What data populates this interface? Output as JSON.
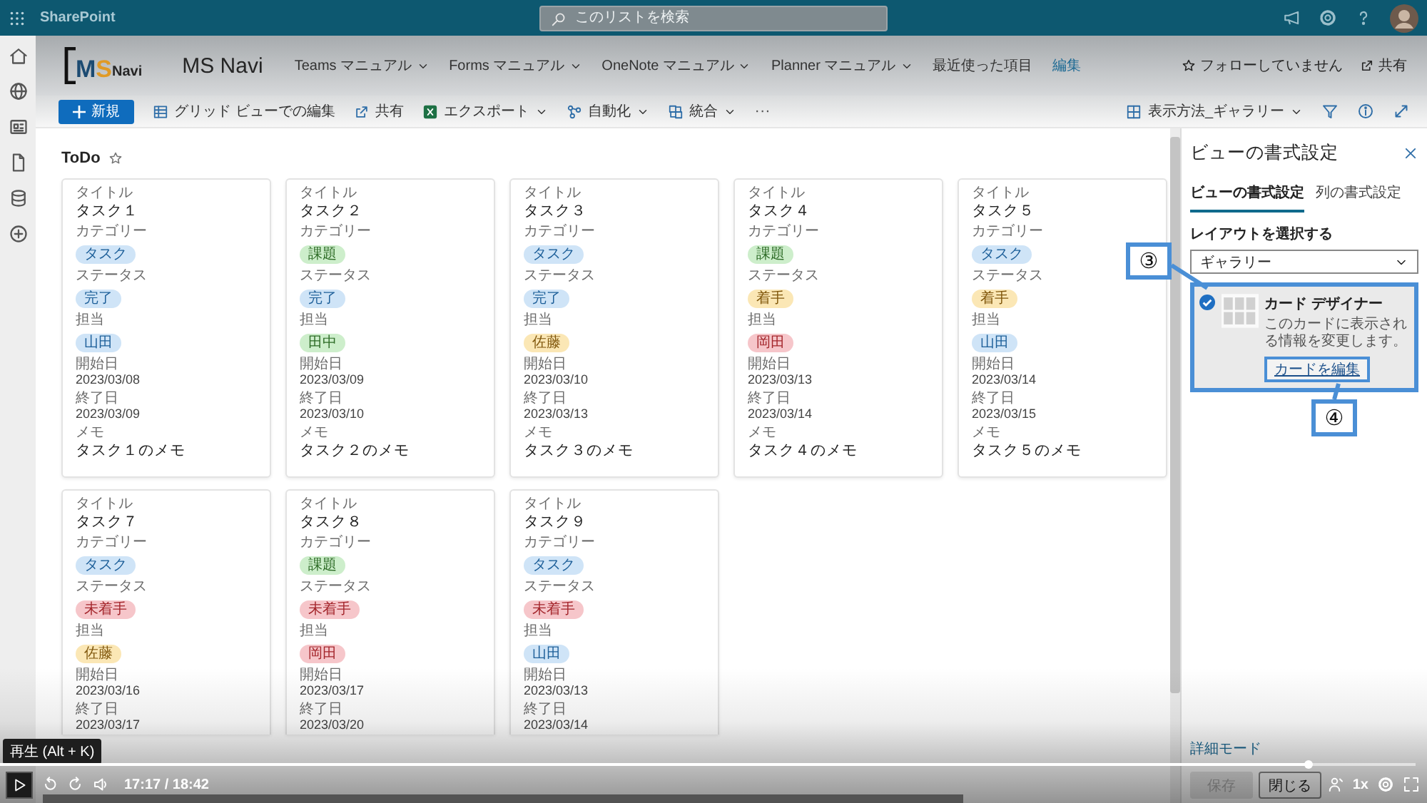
{
  "top_bar": {
    "app_name": "SharePoint",
    "search": {
      "placeholder": "このリストを検索"
    }
  },
  "site_header": {
    "logo_letters": [
      "M",
      "S",
      "Navi"
    ],
    "site_name": "MS Navi",
    "nav": [
      {
        "label": "Teams マニュアル",
        "kind": "menu",
        "dropdown": true
      },
      {
        "label": "Forms マニュアル",
        "kind": "menu",
        "dropdown": true
      },
      {
        "label": "OneNote マニュアル",
        "kind": "menu",
        "dropdown": true
      },
      {
        "label": "Planner マニュアル",
        "kind": "menu",
        "dropdown": true
      },
      {
        "label": "最近使った項目",
        "kind": "menu",
        "dropdown": false
      },
      {
        "label": "編集",
        "kind": "link",
        "dropdown": false
      }
    ],
    "follow": "フォローしていません",
    "share": "共有"
  },
  "command_bar": {
    "new": "新規",
    "items": [
      {
        "label": "グリッド ビューでの編集",
        "kind": "grid",
        "dropdown": false
      },
      {
        "label": "共有",
        "kind": "share",
        "dropdown": false
      },
      {
        "label": "エクスポート",
        "kind": "excel",
        "dropdown": true
      },
      {
        "label": "自動化",
        "kind": "flow",
        "dropdown": true
      },
      {
        "label": "統合",
        "kind": "integrate",
        "dropdown": true
      }
    ],
    "more": "···",
    "view": "表示方法_ギャラリー"
  },
  "list": {
    "title": "ToDo",
    "favorite": false
  },
  "cards": [
    {
      "fields": [
        {
          "kind": "title",
          "label": "タイトル",
          "value": "タスク１"
        },
        {
          "kind": "chip",
          "label": "カテゴリー",
          "value": "タスク",
          "color": "#cfe4f7"
        },
        {
          "kind": "chip",
          "label": "ステータス",
          "value": "完了",
          "color": "#cfe4f7"
        },
        {
          "kind": "chip",
          "label": "担当",
          "value": "山田",
          "color": "#cfe4f7"
        },
        {
          "kind": "date",
          "label": "開始日",
          "value": "2023/03/08"
        },
        {
          "kind": "date",
          "label": "終了日",
          "value": "2023/03/09"
        },
        {
          "kind": "title",
          "label": "メモ",
          "value": "タスク１のメモ"
        }
      ]
    },
    {
      "fields": [
        {
          "kind": "title",
          "label": "タイトル",
          "value": "タスク２"
        },
        {
          "kind": "chip",
          "label": "カテゴリー",
          "value": "課題",
          "color": "#cdeecb"
        },
        {
          "kind": "chip",
          "label": "ステータス",
          "value": "完了",
          "color": "#cfe4f7"
        },
        {
          "kind": "chip",
          "label": "担当",
          "value": "田中",
          "color": "#cdeecb"
        },
        {
          "kind": "date",
          "label": "開始日",
          "value": "2023/03/09"
        },
        {
          "kind": "date",
          "label": "終了日",
          "value": "2023/03/10"
        },
        {
          "kind": "title",
          "label": "メモ",
          "value": "タスク２のメモ"
        }
      ]
    },
    {
      "fields": [
        {
          "kind": "title",
          "label": "タイトル",
          "value": "タスク３"
        },
        {
          "kind": "chip",
          "label": "カテゴリー",
          "value": "タスク",
          "color": "#cfe4f7"
        },
        {
          "kind": "chip",
          "label": "ステータス",
          "value": "完了",
          "color": "#cfe4f7"
        },
        {
          "kind": "chip",
          "label": "担当",
          "value": "佐藤",
          "color": "#fbe7b5"
        },
        {
          "kind": "date",
          "label": "開始日",
          "value": "2023/03/10"
        },
        {
          "kind": "date",
          "label": "終了日",
          "value": "2023/03/13"
        },
        {
          "kind": "title",
          "label": "メモ",
          "value": "タスク３のメモ"
        }
      ]
    },
    {
      "fields": [
        {
          "kind": "title",
          "label": "タイトル",
          "value": "タスク４"
        },
        {
          "kind": "chip",
          "label": "カテゴリー",
          "value": "課題",
          "color": "#cdeecb"
        },
        {
          "kind": "chip",
          "label": "ステータス",
          "value": "着手",
          "color": "#fbe7b5"
        },
        {
          "kind": "chip",
          "label": "担当",
          "value": "岡田",
          "color": "#f6c6ca"
        },
        {
          "kind": "date",
          "label": "開始日",
          "value": "2023/03/13"
        },
        {
          "kind": "date",
          "label": "終了日",
          "value": "2023/03/14"
        },
        {
          "kind": "title",
          "label": "メモ",
          "value": "タスク４のメモ"
        }
      ]
    },
    {
      "fields": [
        {
          "kind": "title",
          "label": "タイトル",
          "value": "タスク５"
        },
        {
          "kind": "chip",
          "label": "カテゴリー",
          "value": "タスク",
          "color": "#cfe4f7"
        },
        {
          "kind": "chip",
          "label": "ステータス",
          "value": "着手",
          "color": "#fbe7b5"
        },
        {
          "kind": "chip",
          "label": "担当",
          "value": "山田",
          "color": "#cfe4f7"
        },
        {
          "kind": "date",
          "label": "開始日",
          "value": "2023/03/14"
        },
        {
          "kind": "date",
          "label": "終了日",
          "value": "2023/03/15"
        },
        {
          "kind": "title",
          "label": "メモ",
          "value": "タスク５のメモ"
        }
      ]
    },
    {
      "fields": [
        {
          "kind": "title",
          "label": "タイトル",
          "value": "タスク７"
        },
        {
          "kind": "chip",
          "label": "カテゴリー",
          "value": "タスク",
          "color": "#cfe4f7"
        },
        {
          "kind": "chip",
          "label": "ステータス",
          "value": "未着手",
          "color": "#f6c6ca"
        },
        {
          "kind": "chip",
          "label": "担当",
          "value": "佐藤",
          "color": "#fbe7b5"
        },
        {
          "kind": "date",
          "label": "開始日",
          "value": "2023/03/16"
        },
        {
          "kind": "date",
          "label": "終了日",
          "value": "2023/03/17"
        }
      ]
    },
    {
      "fields": [
        {
          "kind": "title",
          "label": "タイトル",
          "value": "タスク８"
        },
        {
          "kind": "chip",
          "label": "カテゴリー",
          "value": "課題",
          "color": "#cdeecb"
        },
        {
          "kind": "chip",
          "label": "ステータス",
          "value": "未着手",
          "color": "#f6c6ca"
        },
        {
          "kind": "chip",
          "label": "担当",
          "value": "岡田",
          "color": "#f6c6ca"
        },
        {
          "kind": "date",
          "label": "開始日",
          "value": "2023/03/17"
        },
        {
          "kind": "date",
          "label": "終了日",
          "value": "2023/03/20"
        }
      ]
    },
    {
      "fields": [
        {
          "kind": "title",
          "label": "タイトル",
          "value": "タスク９"
        },
        {
          "kind": "chip",
          "label": "カテゴリー",
          "value": "タスク",
          "color": "#cfe4f7"
        },
        {
          "kind": "chip",
          "label": "ステータス",
          "value": "未着手",
          "color": "#f6c6ca"
        },
        {
          "kind": "chip",
          "label": "担当",
          "value": "山田",
          "color": "#cfe4f7"
        },
        {
          "kind": "date",
          "label": "開始日",
          "value": "2023/03/13"
        },
        {
          "kind": "date",
          "label": "終了日",
          "value": "2023/03/14"
        }
      ]
    }
  ],
  "panel": {
    "title": "ビューの書式設定",
    "tabs": [
      {
        "label": "ビューの書式設定",
        "selected": true
      },
      {
        "label": "列の書式設定",
        "selected": false
      }
    ],
    "layout_label": "レイアウトを選択する",
    "layout_value": "ギャラリー",
    "designer": {
      "checked": true,
      "title": "カード デザイナー",
      "description": "このカードに表示される情報を変更します。",
      "link": "カードを編集"
    },
    "advanced_link": "詳細モード",
    "buttons": [
      {
        "label": "保存",
        "disabled": true
      },
      {
        "label": "閉じる",
        "disabled": false
      }
    ]
  },
  "annotations": [
    {
      "label": "③"
    },
    {
      "label": "④"
    }
  ],
  "player": {
    "tooltip": "再生 (Alt + K)",
    "time": "17:17 / 18:42",
    "progress": {
      "level": 0.924
    },
    "speed": "1x"
  }
}
